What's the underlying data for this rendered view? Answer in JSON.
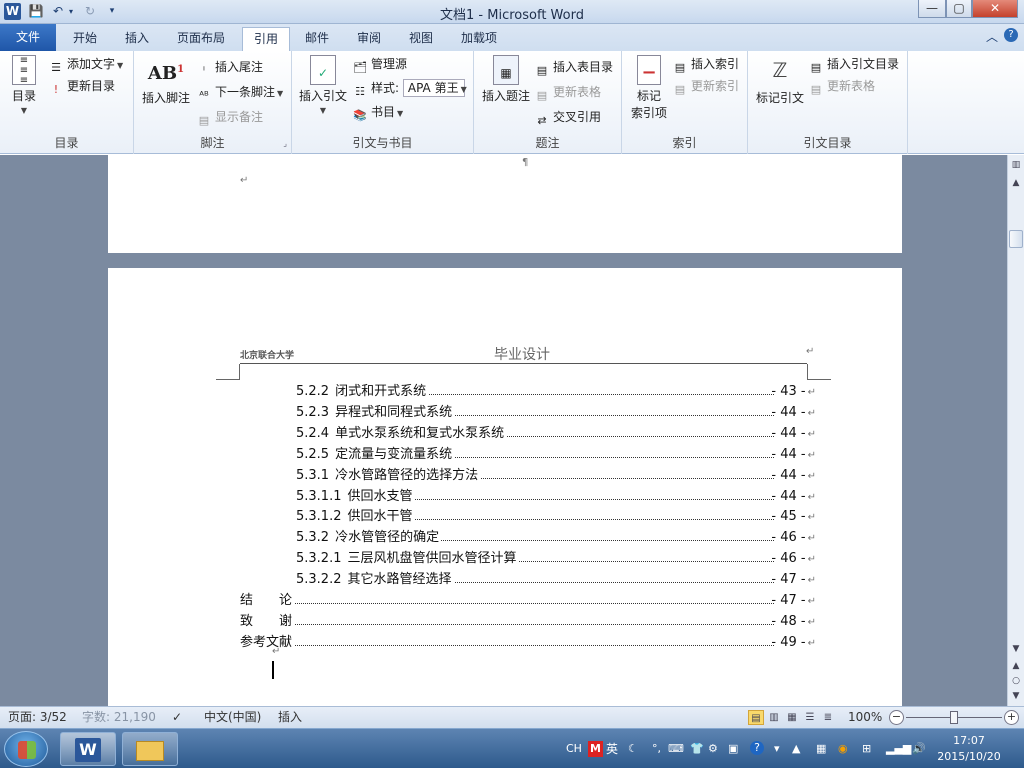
{
  "titlebar": {
    "title": "文档1  -  Microsoft Word",
    "app_icon": "W",
    "qat": [
      "save-icon",
      "undo-icon",
      "redo-icon",
      "customize-icon"
    ],
    "win_buttons": [
      "—",
      "▢",
      "✕"
    ]
  },
  "tabs": [
    "文件",
    "开始",
    "插入",
    "页面布局",
    "引用",
    "邮件",
    "审阅",
    "视图",
    "加载项"
  ],
  "active_tab": "引用",
  "ribbon": {
    "toc_group": {
      "label": "目录",
      "big": "目录",
      "add_text": "添加文字",
      "update_toc": "更新目录"
    },
    "footnote_group": {
      "label": "脚注",
      "big": "插入脚注",
      "insert_endnote": "插入尾注",
      "next_footnote": "下一条脚注",
      "show_notes": "显示备注",
      "ab_icon": "AB"
    },
    "citation_group": {
      "label": "引文与书目",
      "big": "插入引文",
      "manage_sources": "管理源",
      "style_label": "样式:",
      "style_value": "APA 第王",
      "bibliography": "书目"
    },
    "caption_group": {
      "label": "题注",
      "big": "插入题注",
      "insert_tof": "插入表目录",
      "update_table": "更新表格",
      "cross_ref": "交叉引用"
    },
    "index_group": {
      "label": "索引",
      "big_line1": "标记",
      "big_line2": "索引项",
      "insert_index": "插入索引",
      "update_index": "更新索引"
    },
    "toa_group": {
      "label": "引文目录",
      "big": "标记引文",
      "insert_toa": "插入引文目录",
      "update_table": "更新表格"
    }
  },
  "document": {
    "page1_marks": [
      "¶",
      "↵"
    ],
    "header_left": "北京联合大学",
    "header_center": "毕业设计",
    "header_mark": "↵",
    "toc": [
      {
        "num": "5.2.2",
        "text": "闭式和开式系统",
        "page": "- 43 -"
      },
      {
        "num": "5.2.3",
        "text": "异程式和同程式系统",
        "page": "- 44 -"
      },
      {
        "num": "5.2.4",
        "text": "单式水泵系统和复式水泵系统",
        "page": "- 44 -"
      },
      {
        "num": "5.2.5",
        "text": "定流量与变流量系统",
        "page": "- 44 -"
      },
      {
        "num": "5.3.1",
        "text": "冷水管路管径的选择方法",
        "page": "- 44 -"
      },
      {
        "num": "5.3.1.1",
        "text": "供回水支管",
        "page": "- 44 -"
      },
      {
        "num": "5.3.1.2",
        "text": "供回水干管",
        "page": "- 45 -"
      },
      {
        "num": "5.3.2",
        "text": "冷水管管径的确定",
        "page": "- 46 -"
      },
      {
        "num": "5.3.2.1",
        "text": "三层风机盘管供回水管径计算",
        "page": "- 46 -"
      },
      {
        "num": "5.3.2.2",
        "text": "其它水路管经选择",
        "page": "- 47 -"
      },
      {
        "num": "",
        "text": "结　　论",
        "page": "- 47 -"
      },
      {
        "num": "",
        "text": "致　　谢",
        "page": "- 48 -"
      },
      {
        "num": "",
        "text": "参考文献",
        "page": "- 49 -"
      }
    ],
    "para_mark": "↵"
  },
  "statusbar": {
    "page": "页面: 3/52",
    "words": "字数: 21,190",
    "language": "中文(中国)",
    "mode": "插入",
    "zoom": "100%"
  },
  "taskbar": {
    "tray_items": [
      "CH",
      "M",
      "英"
    ],
    "time": "17:07",
    "date": "2015/10/20"
  }
}
